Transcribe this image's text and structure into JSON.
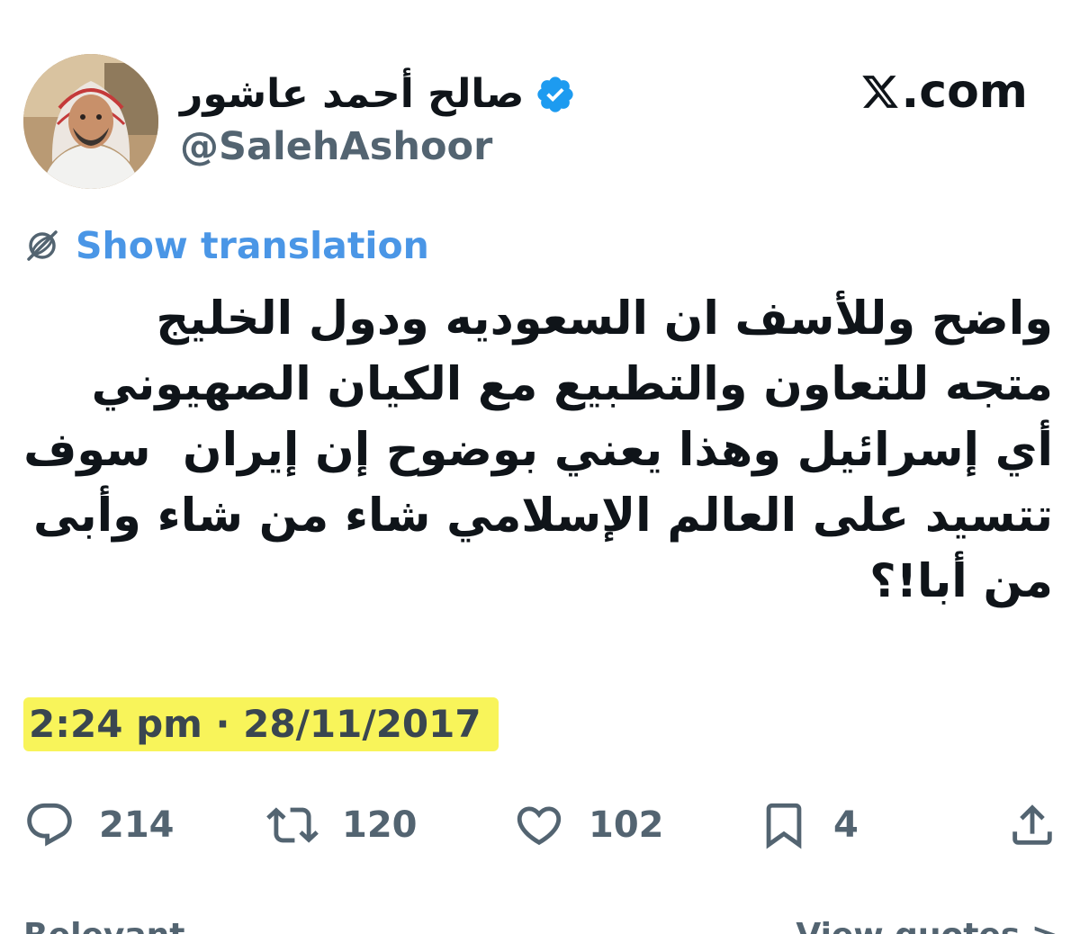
{
  "header": {
    "display_name": "صالح أحمد عاشور",
    "handle": "@SalehAshoor",
    "verified": true,
    "site_label": ".com",
    "site_logo_icon": "x-logo-icon"
  },
  "translation": {
    "icon": "globe-icon",
    "label": "Show translation"
  },
  "tweet": {
    "lines": [
      "واضح وللأسف ان السعوديه ودول الخليج",
      "متجه للتعاون والتطبيع مع الكيان الصهيوني",
      "أي إسرائيل وهذا يعني بوضوح إن إيران  سوف",
      "تتسيد على العالم الإسلامي شاء من شاء وأبى",
      "من أبا!؟"
    ]
  },
  "timestamp": {
    "text": "2:24 pm · 28/11/2017",
    "highlight_color": "#f8f45a"
  },
  "actions": [
    {
      "name": "reply",
      "icon": "reply-icon",
      "count": "214"
    },
    {
      "name": "retweet",
      "icon": "retweet-icon",
      "count": "120"
    },
    {
      "name": "like",
      "icon": "heart-icon",
      "count": "102"
    },
    {
      "name": "bookmark",
      "icon": "bookmark-icon",
      "count": "4"
    },
    {
      "name": "share",
      "icon": "share-icon",
      "count": ""
    }
  ],
  "bottom": {
    "left_label": "Relevant",
    "right_label": "View quotes >"
  },
  "colors": {
    "text": "#0f1419",
    "secondary": "#536471",
    "link": "#4a96e6",
    "verified": "#1d9bf0"
  }
}
